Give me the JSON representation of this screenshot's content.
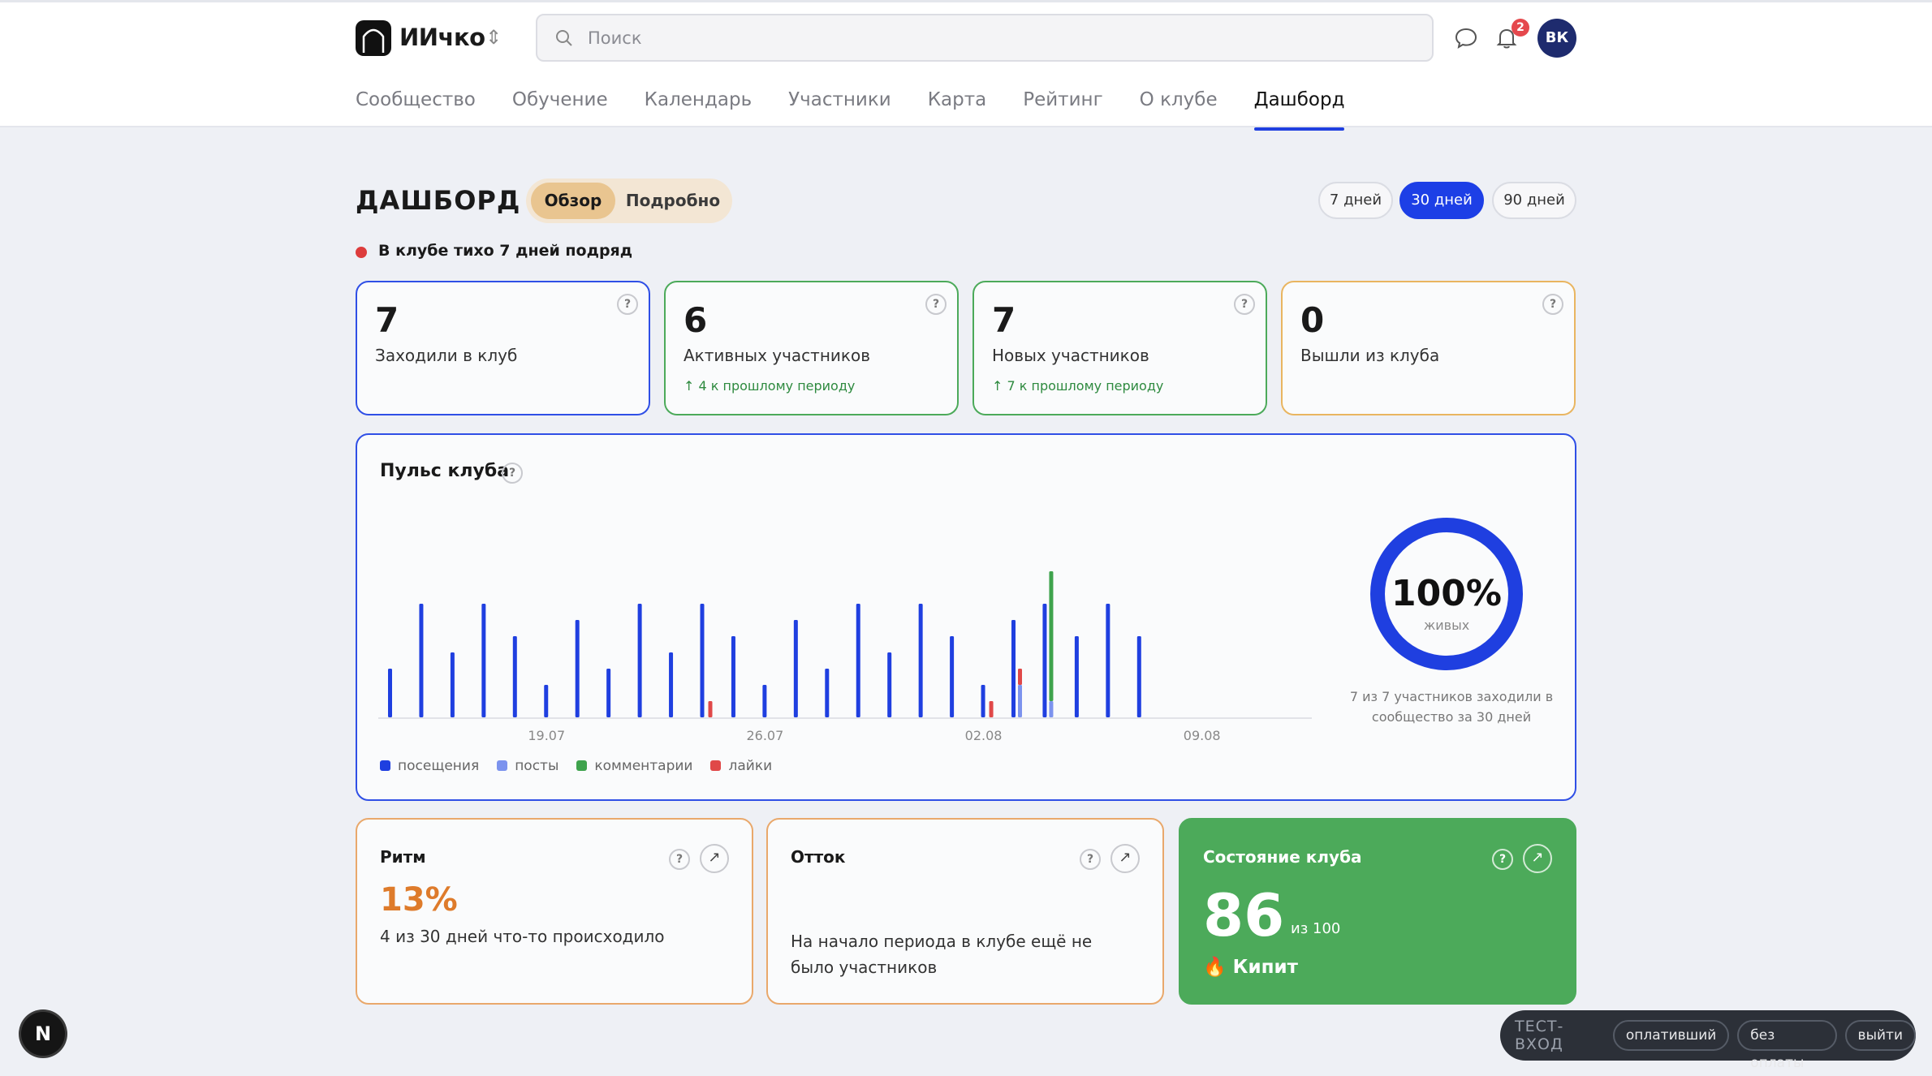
{
  "header": {
    "brand": "ИИчко",
    "brand_switch_icon": "chevron-up-down-icon",
    "search_placeholder": "Поиск",
    "notifications_count": "2",
    "avatar_initials": "ВК",
    "icons": [
      "search-icon",
      "chat-icon",
      "bell-icon"
    ]
  },
  "nav": {
    "items": [
      {
        "label": "Сообщество"
      },
      {
        "label": "Обучение"
      },
      {
        "label": "Календарь"
      },
      {
        "label": "Участники"
      },
      {
        "label": "Карта"
      },
      {
        "label": "Рейтинг"
      },
      {
        "label": "О клубе"
      },
      {
        "label": "Дашборд"
      }
    ],
    "active": "Дашборд"
  },
  "dashboard": {
    "title": "ДАШБОРД",
    "view_tabs": {
      "overview": "Обзор",
      "details": "Подробно",
      "active": "Обзор"
    },
    "periods": [
      {
        "label": "7 дней"
      },
      {
        "label": "30 дней"
      },
      {
        "label": "90 дней"
      }
    ],
    "active_period": "30 дней",
    "alert": "В клубе тихо 7 дней подряд",
    "stats": [
      {
        "value": "7",
        "label": "Заходили в клуб",
        "trend": "",
        "color": "#2f4fe6"
      },
      {
        "value": "6",
        "label": "Активных участников",
        "trend": "↑ 4 к прошлому периоду",
        "color": "#4caa5a"
      },
      {
        "value": "7",
        "label": "Новых участников",
        "trend": "↑ 7 к прошлому периоду",
        "color": "#4caa5a"
      },
      {
        "value": "0",
        "label": "Вышли из клуба",
        "trend": "",
        "color": "#e9b560"
      }
    ],
    "pulse": {
      "title": "Пульс клуба",
      "ring_value": "100%",
      "ring_label": "живых",
      "ring_fraction": 1.0,
      "ring_caption": "7 из 7 участников заходили в сообщество за 30 дней"
    },
    "rhythm": {
      "title": "Ритм",
      "value": "13%",
      "text": "4 из 30 дней что-то происходило"
    },
    "churn": {
      "title": "Отток",
      "text": "На начало периода в клубе ещё не было участников"
    },
    "health": {
      "title": "Состояние клуба",
      "score": "86",
      "score_of": "из 100",
      "state_icon": "fire-icon",
      "state": "Кипит"
    }
  },
  "chart_data": {
    "type": "bar",
    "x_tick_labels": [
      "19.07",
      "26.07",
      "02.08",
      "09.08"
    ],
    "x_tick_index": [
      5,
      12,
      19,
      26
    ],
    "legend_position": "bottom-left",
    "series": [
      {
        "name": "посещения",
        "color": "#1f3fe0",
        "values": [
          3,
          7,
          4,
          7,
          5,
          2,
          6,
          3,
          7,
          4,
          7,
          5,
          2,
          6,
          3,
          7,
          4,
          7,
          5,
          2,
          6,
          7,
          5,
          7,
          5,
          0,
          0,
          0,
          0,
          0
        ]
      },
      {
        "name": "посты",
        "color": "#7c93ee",
        "values": [
          0,
          0,
          0,
          0,
          0,
          0,
          0,
          0,
          0,
          0,
          0,
          0,
          0,
          0,
          0,
          0,
          0,
          0,
          0,
          0,
          2,
          0,
          0,
          0,
          0,
          0,
          0,
          0,
          0,
          0
        ]
      },
      {
        "name": "комментарии",
        "color": "#3fa34d",
        "values": [
          0,
          0,
          0,
          0,
          0,
          0,
          0,
          0,
          0,
          0,
          0,
          0,
          0,
          0,
          0,
          0,
          0,
          0,
          0,
          0,
          0,
          9,
          0,
          0,
          0,
          0,
          0,
          0,
          0,
          0
        ]
      },
      {
        "name": "лайки",
        "color": "#e04848",
        "values": [
          0,
          0,
          0,
          0,
          0,
          0,
          0,
          0,
          0,
          0,
          1,
          0,
          0,
          0,
          0,
          0,
          0,
          0,
          0,
          1,
          3,
          0,
          0,
          0,
          0,
          0,
          0,
          0,
          0,
          0
        ]
      }
    ]
  },
  "dev": {
    "badge": "N",
    "test_label": "ТЕСТ-ВХОД",
    "buttons": [
      {
        "label": "оплативший"
      },
      {
        "label": "без оплаты"
      },
      {
        "label": "выйти"
      }
    ]
  }
}
